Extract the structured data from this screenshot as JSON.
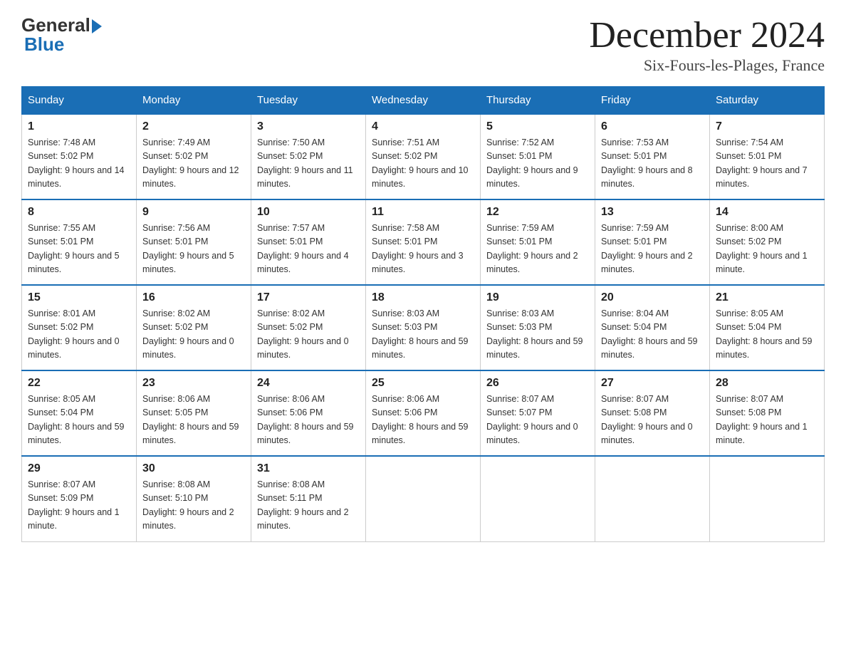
{
  "logo": {
    "general": "General",
    "blue": "Blue"
  },
  "header": {
    "month": "December 2024",
    "location": "Six-Fours-les-Plages, France"
  },
  "weekdays": [
    "Sunday",
    "Monday",
    "Tuesday",
    "Wednesday",
    "Thursday",
    "Friday",
    "Saturday"
  ],
  "weeks": [
    [
      {
        "day": "1",
        "sunrise": "7:48 AM",
        "sunset": "5:02 PM",
        "daylight": "9 hours and 14 minutes."
      },
      {
        "day": "2",
        "sunrise": "7:49 AM",
        "sunset": "5:02 PM",
        "daylight": "9 hours and 12 minutes."
      },
      {
        "day": "3",
        "sunrise": "7:50 AM",
        "sunset": "5:02 PM",
        "daylight": "9 hours and 11 minutes."
      },
      {
        "day": "4",
        "sunrise": "7:51 AM",
        "sunset": "5:02 PM",
        "daylight": "9 hours and 10 minutes."
      },
      {
        "day": "5",
        "sunrise": "7:52 AM",
        "sunset": "5:01 PM",
        "daylight": "9 hours and 9 minutes."
      },
      {
        "day": "6",
        "sunrise": "7:53 AM",
        "sunset": "5:01 PM",
        "daylight": "9 hours and 8 minutes."
      },
      {
        "day": "7",
        "sunrise": "7:54 AM",
        "sunset": "5:01 PM",
        "daylight": "9 hours and 7 minutes."
      }
    ],
    [
      {
        "day": "8",
        "sunrise": "7:55 AM",
        "sunset": "5:01 PM",
        "daylight": "9 hours and 5 minutes."
      },
      {
        "day": "9",
        "sunrise": "7:56 AM",
        "sunset": "5:01 PM",
        "daylight": "9 hours and 5 minutes."
      },
      {
        "day": "10",
        "sunrise": "7:57 AM",
        "sunset": "5:01 PM",
        "daylight": "9 hours and 4 minutes."
      },
      {
        "day": "11",
        "sunrise": "7:58 AM",
        "sunset": "5:01 PM",
        "daylight": "9 hours and 3 minutes."
      },
      {
        "day": "12",
        "sunrise": "7:59 AM",
        "sunset": "5:01 PM",
        "daylight": "9 hours and 2 minutes."
      },
      {
        "day": "13",
        "sunrise": "7:59 AM",
        "sunset": "5:01 PM",
        "daylight": "9 hours and 2 minutes."
      },
      {
        "day": "14",
        "sunrise": "8:00 AM",
        "sunset": "5:02 PM",
        "daylight": "9 hours and 1 minute."
      }
    ],
    [
      {
        "day": "15",
        "sunrise": "8:01 AM",
        "sunset": "5:02 PM",
        "daylight": "9 hours and 0 minutes."
      },
      {
        "day": "16",
        "sunrise": "8:02 AM",
        "sunset": "5:02 PM",
        "daylight": "9 hours and 0 minutes."
      },
      {
        "day": "17",
        "sunrise": "8:02 AM",
        "sunset": "5:02 PM",
        "daylight": "9 hours and 0 minutes."
      },
      {
        "day": "18",
        "sunrise": "8:03 AM",
        "sunset": "5:03 PM",
        "daylight": "8 hours and 59 minutes."
      },
      {
        "day": "19",
        "sunrise": "8:03 AM",
        "sunset": "5:03 PM",
        "daylight": "8 hours and 59 minutes."
      },
      {
        "day": "20",
        "sunrise": "8:04 AM",
        "sunset": "5:04 PM",
        "daylight": "8 hours and 59 minutes."
      },
      {
        "day": "21",
        "sunrise": "8:05 AM",
        "sunset": "5:04 PM",
        "daylight": "8 hours and 59 minutes."
      }
    ],
    [
      {
        "day": "22",
        "sunrise": "8:05 AM",
        "sunset": "5:04 PM",
        "daylight": "8 hours and 59 minutes."
      },
      {
        "day": "23",
        "sunrise": "8:06 AM",
        "sunset": "5:05 PM",
        "daylight": "8 hours and 59 minutes."
      },
      {
        "day": "24",
        "sunrise": "8:06 AM",
        "sunset": "5:06 PM",
        "daylight": "8 hours and 59 minutes."
      },
      {
        "day": "25",
        "sunrise": "8:06 AM",
        "sunset": "5:06 PM",
        "daylight": "8 hours and 59 minutes."
      },
      {
        "day": "26",
        "sunrise": "8:07 AM",
        "sunset": "5:07 PM",
        "daylight": "9 hours and 0 minutes."
      },
      {
        "day": "27",
        "sunrise": "8:07 AM",
        "sunset": "5:08 PM",
        "daylight": "9 hours and 0 minutes."
      },
      {
        "day": "28",
        "sunrise": "8:07 AM",
        "sunset": "5:08 PM",
        "daylight": "9 hours and 1 minute."
      }
    ],
    [
      {
        "day": "29",
        "sunrise": "8:07 AM",
        "sunset": "5:09 PM",
        "daylight": "9 hours and 1 minute."
      },
      {
        "day": "30",
        "sunrise": "8:08 AM",
        "sunset": "5:10 PM",
        "daylight": "9 hours and 2 minutes."
      },
      {
        "day": "31",
        "sunrise": "8:08 AM",
        "sunset": "5:11 PM",
        "daylight": "9 hours and 2 minutes."
      },
      null,
      null,
      null,
      null
    ]
  ],
  "labels": {
    "sunrise": "Sunrise:",
    "sunset": "Sunset:",
    "daylight": "Daylight:"
  }
}
